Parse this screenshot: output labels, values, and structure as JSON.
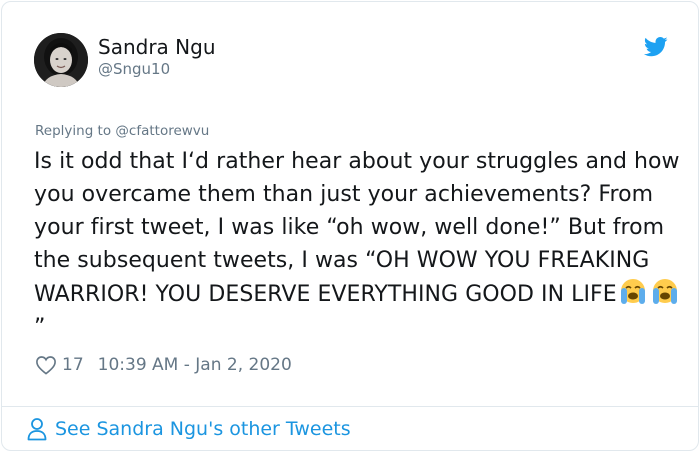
{
  "author": {
    "name": "Sandra Ngu",
    "handle": "@Sngu10"
  },
  "reply": {
    "prefix": "Replying to ",
    "mention": "@cfattorewvu"
  },
  "tweet": {
    "text": "Is it odd that I‘d rather hear about your struggles and how you overcame them than just your achievements? From your first tweet, I was like “oh wow, well done!” But from the subsequent tweets, I was “OH WOW YOU FREAKING WARRIOR! YOU DESERVE EVERYTHING GOOD IN LIFE",
    "closing": "”",
    "emojis": [
      "loudly-crying-face",
      "loudly-crying-face"
    ]
  },
  "meta": {
    "likes": "17",
    "timestamp": "10:39 AM - Jan 2, 2020"
  },
  "footer": {
    "link_text": "See Sandra Ngu's other Tweets"
  },
  "colors": {
    "twitter_blue": "#1da1f2",
    "link_blue": "#1b95e0",
    "muted_gray": "#657786"
  },
  "icons": {
    "brand": "twitter-bird-icon",
    "like": "heart-outline-icon",
    "profile": "person-outline-icon"
  }
}
